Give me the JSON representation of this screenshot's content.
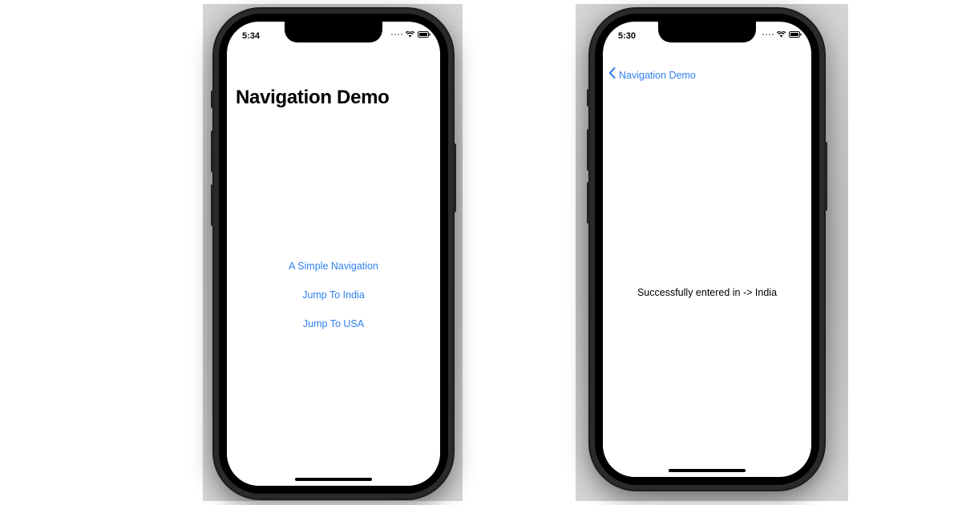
{
  "screens": [
    {
      "status_time": "5:34",
      "title": "Navigation Demo",
      "links": [
        {
          "label": "A Simple Navigation"
        },
        {
          "label": "Jump To India"
        },
        {
          "label": "Jump To USA"
        }
      ],
      "icons": [
        "wifi-icon",
        "battery-icon",
        "signal-icon"
      ]
    },
    {
      "status_time": "5:30",
      "back_label": "Navigation Demo",
      "message": "Successfully entered in -> India",
      "icons": [
        "chevron-left-icon",
        "wifi-icon",
        "battery-icon",
        "signal-icon"
      ]
    }
  ],
  "colors": {
    "accent": "#2f80ed",
    "text": "#000000",
    "screen_bg": "#ffffff"
  }
}
